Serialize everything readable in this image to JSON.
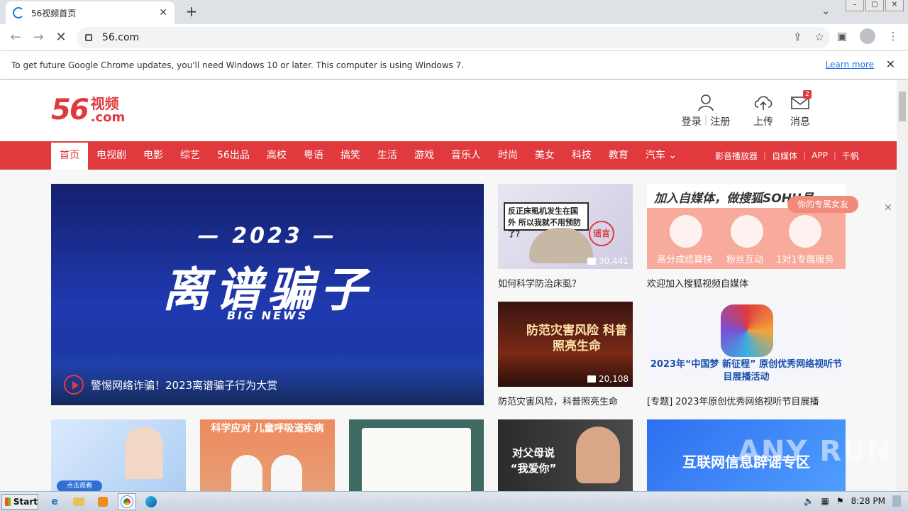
{
  "browser": {
    "tab_title": "56视频首页",
    "url": "56.com",
    "infobar_text": "To get future Google Chrome updates, you'll need Windows 10 or later. This computer is using Windows 7.",
    "learn_more": "Learn more"
  },
  "header": {
    "logo_number": "56",
    "logo_word": "视频",
    "logo_domain": ".com",
    "login": "登录",
    "register": "注册",
    "upload": "上传",
    "messages": "消息",
    "message_count": "2"
  },
  "nav": {
    "items": [
      "首页",
      "电视剧",
      "电影",
      "综艺",
      "56出品",
      "高校",
      "粤语",
      "搞笑",
      "生活",
      "游戏",
      "音乐人",
      "时尚",
      "美女",
      "科技",
      "教育",
      "汽车"
    ],
    "right": [
      "影音播放器",
      "自媒体",
      "APP",
      "千帆"
    ]
  },
  "banner": {
    "year": "— 2023 —",
    "headline": "离谱骗子",
    "subtitle": "BIG NEWS",
    "caption": "警惕网络诈骗！2023离谱骗子行为大赏"
  },
  "cards": [
    {
      "thumb_text": "反正床虱机发生在国外 所以我就不用预防了？",
      "stamp": "谣言",
      "views": "30,441",
      "label": "如何科学防治床虱？"
    },
    {
      "thumb_text": "加入自媒体，做搜狐SOHU号",
      "features": [
        "高分成结算快",
        "粉丝互动",
        "1对1专属服务"
      ],
      "label": "欢迎加入搜狐视频自媒体"
    },
    {
      "thumb_text": "防范灾害风险 科普照亮生命",
      "views": "20,108",
      "label": "防范灾害风险，科普照亮生命"
    },
    {
      "thumb_text": "2023年“中国梦 新征程” 原创优秀网络视听节目展播活动",
      "label": "[专题] 2023年原创优秀网络视听节目展播"
    }
  ],
  "bottom_cards": [
    {
      "thumb_text": "点击观看"
    },
    {
      "thumb_text": "科学应对 儿童呼吸道疾病"
    },
    {
      "thumb_text": ""
    },
    {
      "thumb_text": "对父母说 “我爱你”"
    },
    {
      "thumb_text": "互联网信息辟谣专区"
    }
  ],
  "ad": {
    "pill": "你的专属女友"
  },
  "watermark": "ANY RUN",
  "taskbar": {
    "start": "Start",
    "time": "8:28 PM"
  },
  "colors": {
    "brand": "#e03a3e",
    "chrome_blue": "#1a73e8"
  }
}
